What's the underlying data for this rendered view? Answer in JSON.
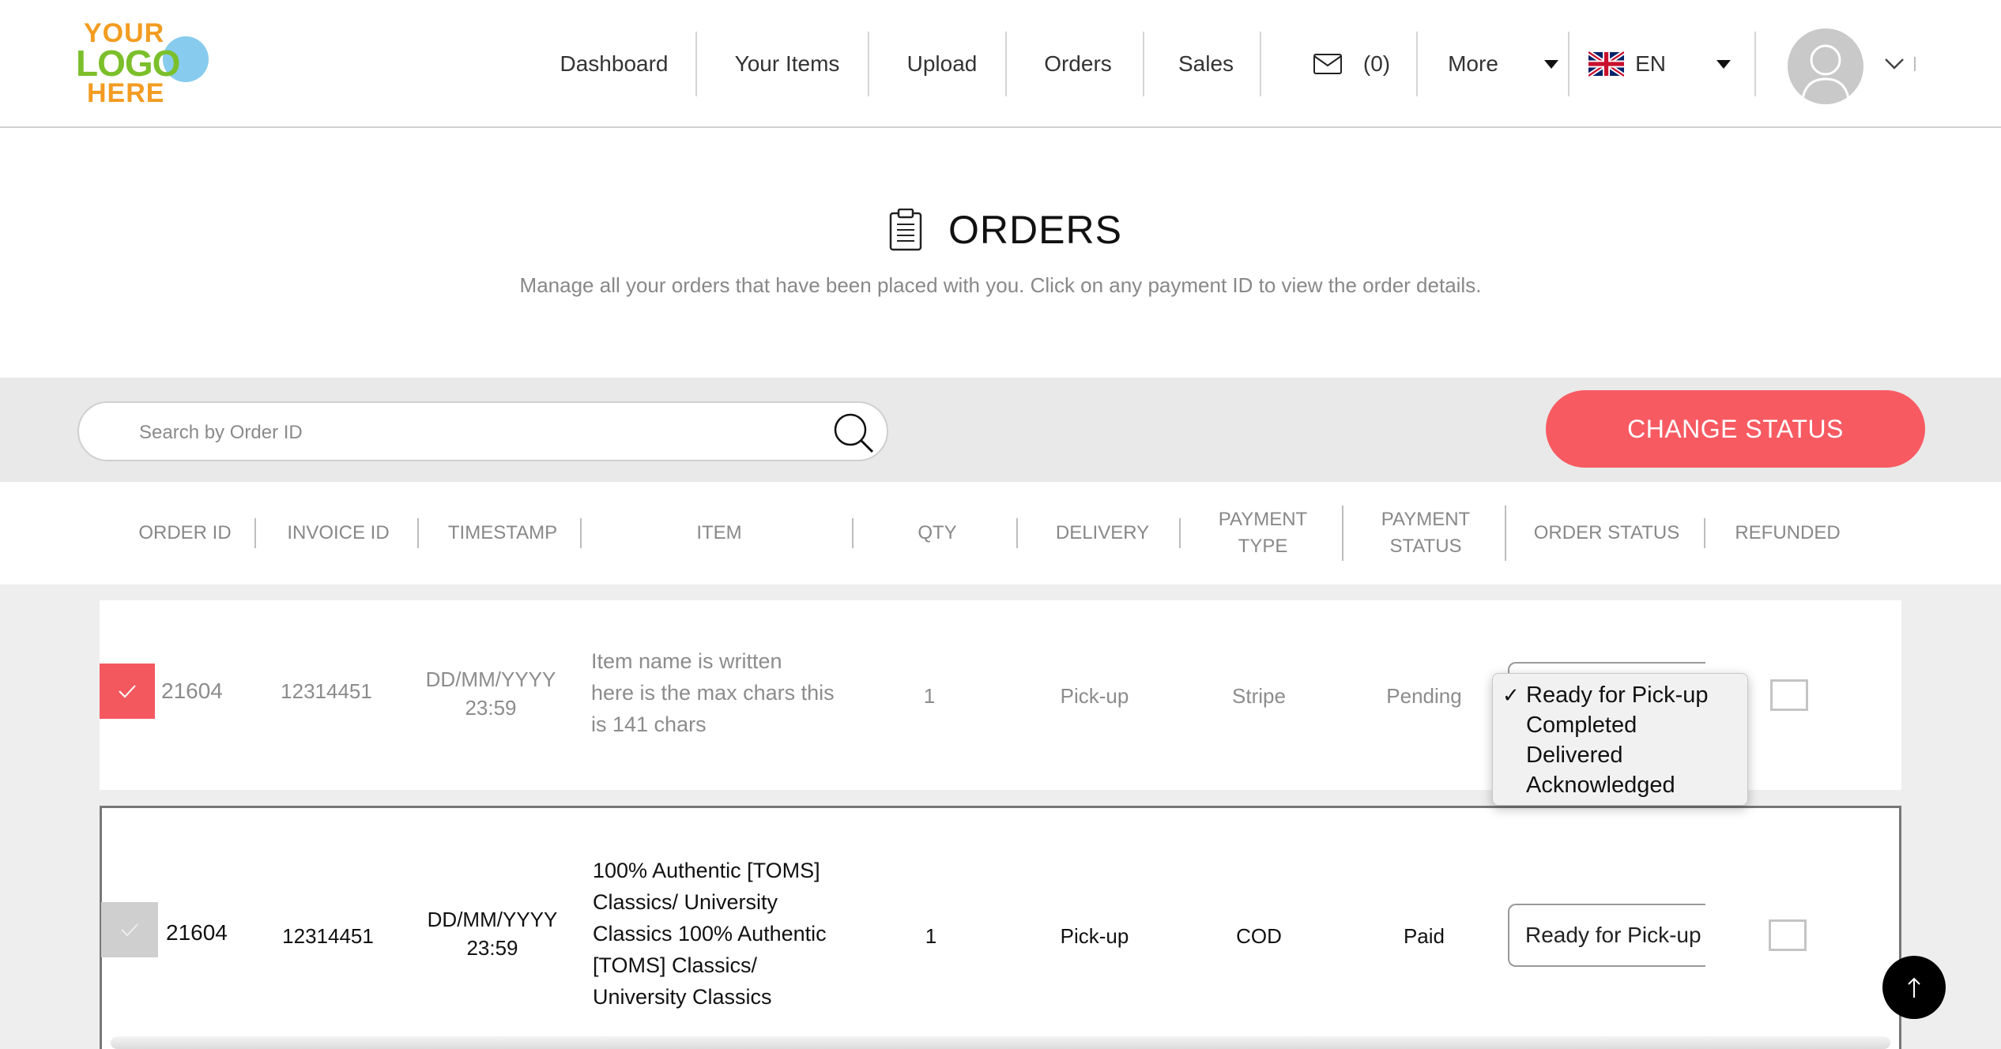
{
  "logo": {
    "line1": "YOUR",
    "line2": "LOGO",
    "line3": "HERE"
  },
  "nav": {
    "dashboard": "Dashboard",
    "your_items": "Your Items",
    "upload": "Upload",
    "orders": "Orders",
    "sales": "Sales",
    "messages_count": "(0)",
    "more": "More",
    "language": "EN"
  },
  "page": {
    "title": "ORDERS",
    "subtitle": "Manage all your orders that have been placed with you. Click on any payment ID to view the order details."
  },
  "search": {
    "placeholder": "Search by Order ID"
  },
  "actions": {
    "change_status": "CHANGE STATUS"
  },
  "table": {
    "headers": {
      "order_id": "ORDER ID",
      "invoice_id": "INVOICE ID",
      "timestamp": "TIMESTAMP",
      "item": "ITEM",
      "qty": "QTY",
      "delivery": "DELIVERY",
      "payment_type_1": "PAYMENT",
      "payment_type_2": "TYPE",
      "payment_status_1": "PAYMENT",
      "payment_status_2": "STATUS",
      "order_status": "ORDER STATUS",
      "refunded": "REFUNDED"
    },
    "rows": [
      {
        "order_id": "21604",
        "invoice_id": "12314451",
        "timestamp_date": "DD/MM/YYYY",
        "timestamp_time": "23:59",
        "item_l1": "Item name is written",
        "item_l2": "here is the max chars this",
        "item_l3": "is 141 chars",
        "qty": "1",
        "delivery": "Pick-up",
        "payment_type": "Stripe",
        "payment_status": "Pending",
        "selected": true,
        "refunded": false
      },
      {
        "order_id": "21604",
        "invoice_id": "12314451",
        "timestamp_date": "DD/MM/YYYY",
        "timestamp_time": "23:59",
        "item_l1": "100% Authentic [TOMS]",
        "item_l2": "Classics/ University",
        "item_l3": "Classics 100% Authentic",
        "item_l4": "[TOMS] Classics/",
        "item_l5": "University Classics",
        "qty": "1",
        "delivery": "Pick-up",
        "payment_type": "COD",
        "payment_status": "Paid",
        "order_status": "Ready for Pick-up",
        "selected": false,
        "refunded": false
      }
    ]
  },
  "status_dropdown": {
    "options": [
      "Ready for Pick-up",
      "Completed",
      "Delivered",
      "Acknowledged"
    ],
    "selected": "Ready for Pick-up"
  },
  "colors": {
    "accent": "#f85a62",
    "band": "#e9e9e9",
    "muted_text": "#8c8c8c"
  }
}
